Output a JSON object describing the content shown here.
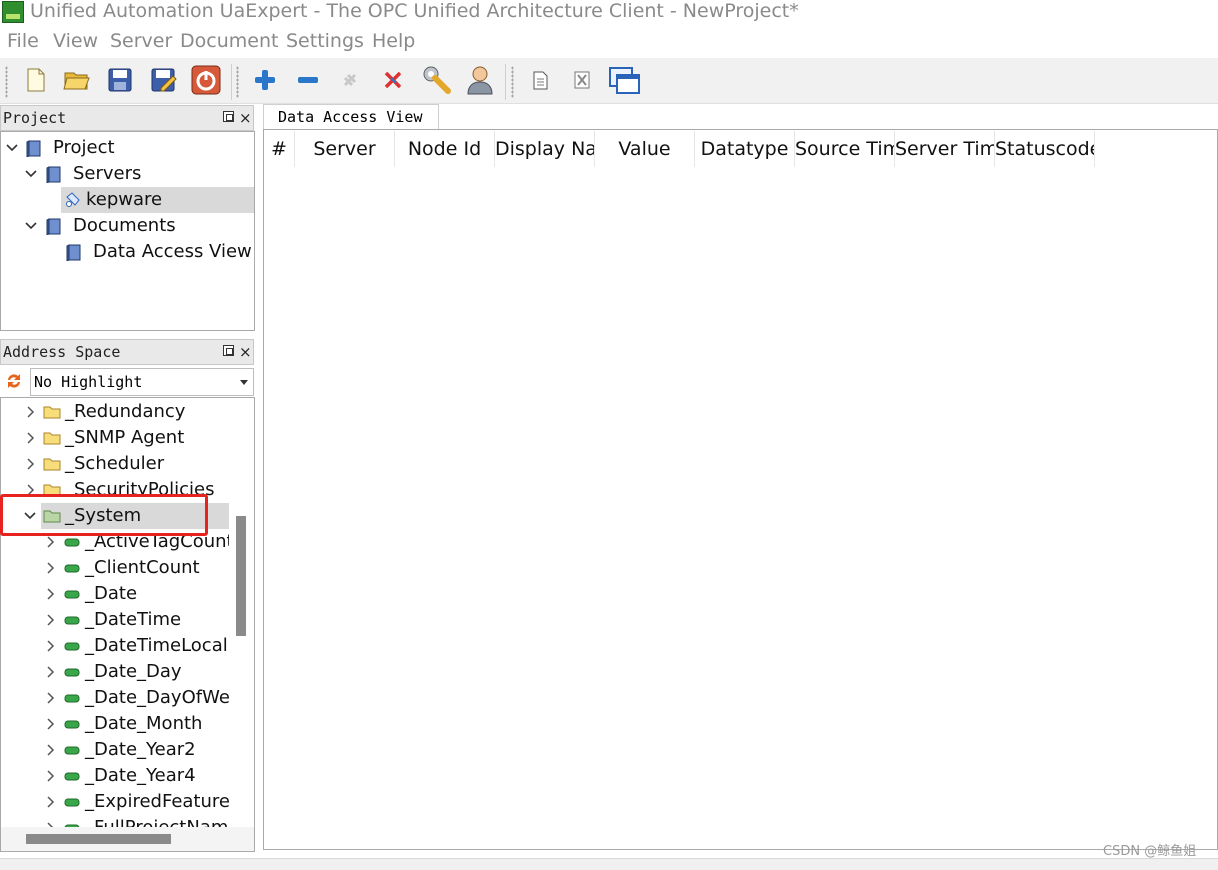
{
  "window": {
    "title": "Unified Automation UaExpert - The OPC Unified Architecture Client - NewProject*"
  },
  "menu": [
    "File",
    "View",
    "Server",
    "Document",
    "Settings",
    "Help"
  ],
  "toolbar": {
    "buttons": [
      "new-project-icon",
      "open-project-icon",
      "save-project-icon",
      "save-as-project-icon",
      "power-off-icon",
      "add-server-icon",
      "remove-server-icon",
      "connect-server-icon",
      "disconnect-server-icon",
      "settings-wrench-icon",
      "user-icon",
      "new-document-icon",
      "close-document-icon",
      "window-icon"
    ]
  },
  "project_panel": {
    "title": "Project",
    "close_glyph": "×",
    "tree": [
      {
        "label": "Project",
        "icon": "book-icon",
        "expanded": true
      },
      {
        "label": "Servers",
        "icon": "book-icon",
        "expanded": true
      },
      {
        "label": "kepware",
        "icon": "server-plug-icon",
        "selected": true
      },
      {
        "label": "Documents",
        "icon": "book-icon",
        "expanded": true
      },
      {
        "label": "Data Access View",
        "icon": "book-icon"
      }
    ]
  },
  "address_space": {
    "title": "Address Space",
    "close_glyph": "×",
    "highlight_value": "No Highlight",
    "items": [
      {
        "label": "_Redundancy",
        "icon": "folder-icon"
      },
      {
        "label": "_SNMP Agent",
        "icon": "folder-icon"
      },
      {
        "label": "_Scheduler",
        "icon": "folder-icon"
      },
      {
        "label": "_SecurityPolicies",
        "icon": "folder-icon"
      },
      {
        "label": "_System",
        "icon": "folder-icon",
        "expanded": true,
        "selected": true
      },
      {
        "label": "_ActiveTagCount",
        "icon": "tag-icon"
      },
      {
        "label": "_ClientCount",
        "icon": "tag-icon"
      },
      {
        "label": "_Date",
        "icon": "tag-icon"
      },
      {
        "label": "_DateTime",
        "icon": "tag-icon"
      },
      {
        "label": "_DateTimeLocal",
        "icon": "tag-icon"
      },
      {
        "label": "_Date_Day",
        "icon": "tag-icon"
      },
      {
        "label": "_Date_DayOfWeek",
        "icon": "tag-icon"
      },
      {
        "label": "_Date_Month",
        "icon": "tag-icon"
      },
      {
        "label": "_Date_Year2",
        "icon": "tag-icon"
      },
      {
        "label": "_Date_Year4",
        "icon": "tag-icon"
      },
      {
        "label": "_ExpiredFeatures",
        "icon": "tag-icon"
      },
      {
        "label": "_FullProjectName",
        "icon": "tag-icon"
      }
    ]
  },
  "document": {
    "tab_label": "Data Access View",
    "columns": [
      "#",
      "Server",
      "Node Id",
      "Display Name",
      "Value",
      "Datatype",
      "Source Timestamp",
      "Server Timestamp",
      "Statuscode"
    ]
  },
  "watermark": "CSDN @鲸鱼姐",
  "colors": {
    "highlight_box": "#e8231f",
    "selected_row": "#d9d9d9",
    "menu_text": "#8a8a8a"
  }
}
